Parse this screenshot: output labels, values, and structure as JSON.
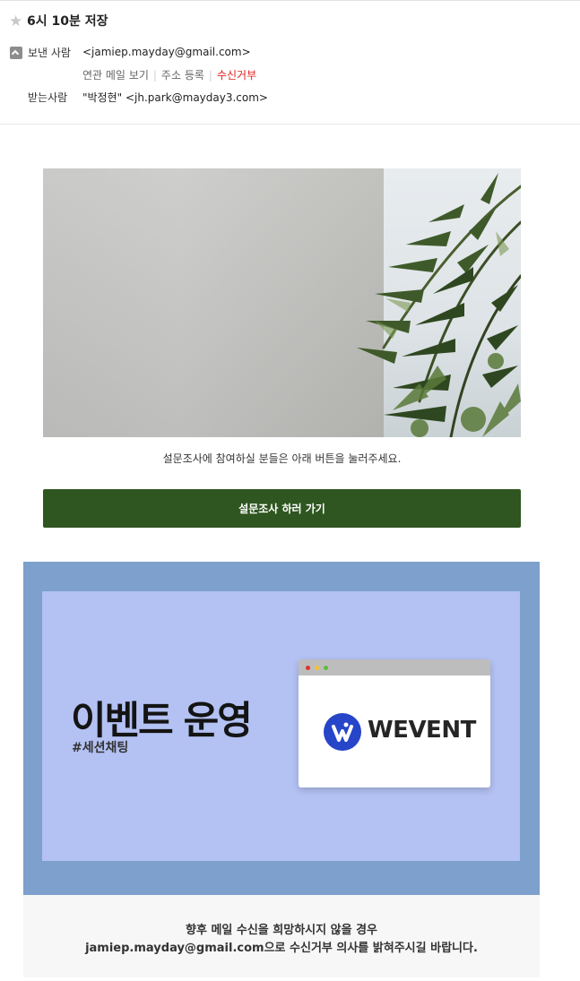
{
  "header": {
    "subject": "6시 10분 저장",
    "from_label": "보낸 사람",
    "from_address": "<jamiep.mayday@gmail.com>",
    "actions": {
      "related_mail": "연관 메일 보기",
      "add_address": "주소 등록",
      "reject": "수신거부"
    },
    "to_label": "받는사람",
    "to_address": "\"박정현\" <jh.park@mayday3.com>"
  },
  "icons": {
    "star": "star-icon",
    "collapse": "collapse-up-icon"
  },
  "body": {
    "survey_text": "설문조사에 참여하실 분들은 아래 버튼을 눌러주세요.",
    "survey_button": "설문조사 하러 가기",
    "promo": {
      "title": "이벤트 운영",
      "tag": "#세션채팅",
      "brand": "WEVENT"
    },
    "notice_line1": "향후 메일 수신을 희망하시지 않을 경우",
    "notice_line2": "jamiep.mayday@gmail.com으로 수신거부 의사를 밝혀주시길 바랍니다."
  },
  "colors": {
    "survey_button": "#2f5620",
    "promo_outer": "#7da0cc",
    "promo_inner": "#b3c1f3",
    "reject_link": "#e02020",
    "brand_blue": "#2645c9"
  }
}
